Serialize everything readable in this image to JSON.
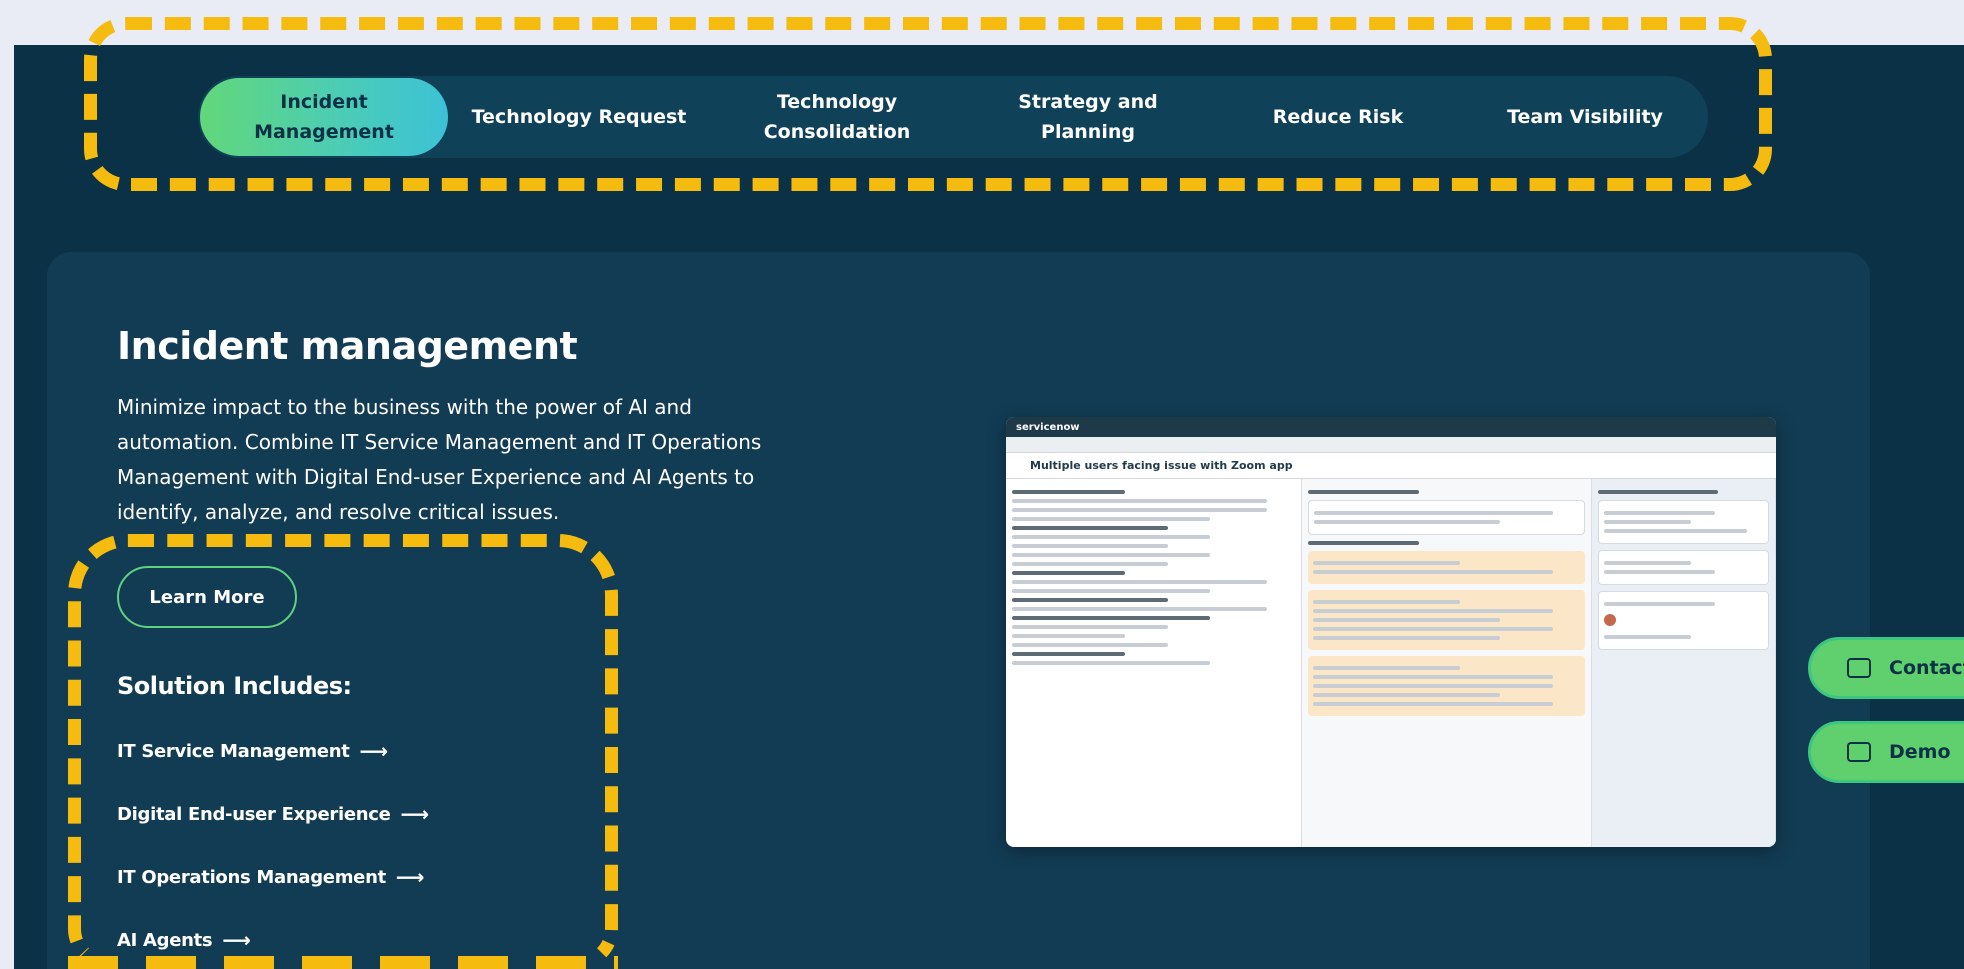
{
  "tabs": [
    {
      "label": "Incident\nManagement",
      "active": true
    },
    {
      "label": "Technology Request",
      "active": false
    },
    {
      "label": "Technology\nConsolidation",
      "active": false
    },
    {
      "label": "Strategy and\nPlanning",
      "active": false
    },
    {
      "label": "Reduce Risk",
      "active": false
    },
    {
      "label": "Team Visibility",
      "active": false
    }
  ],
  "section": {
    "title": "Incident management",
    "description": "Minimize impact to the business with the power of AI and automation. Combine IT Service Management and IT Operations Management with Digital End-user Experience and AI Agents to identify, analyze, and resolve critical issues.",
    "learn_more": "Learn More",
    "solution_title": "Solution Includes:",
    "solutions": [
      {
        "label": "IT Service Management",
        "arrow": "⟶"
      },
      {
        "label": "Digital End-user Experience",
        "arrow": "⟶"
      },
      {
        "label": "IT Operations Management",
        "arrow": "⟶"
      },
      {
        "label": "AI Agents",
        "arrow": "⟶"
      }
    ]
  },
  "screenshot": {
    "brand": "servicenow",
    "heading": "Multiple users facing issue with Zoom app"
  },
  "side_buttons": {
    "contact": "Contact",
    "demo": "Demo"
  },
  "colors": {
    "background": "#0b3147",
    "accent_green": "#5fd06d",
    "highlight_dashes": "#f5bb0e"
  }
}
